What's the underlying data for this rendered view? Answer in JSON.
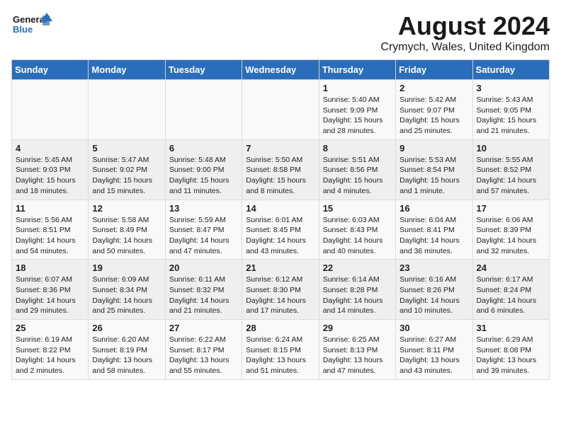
{
  "logo": {
    "line1": "General",
    "line2": "Blue"
  },
  "title": "August 2024",
  "subtitle": "Crymych, Wales, United Kingdom",
  "weekdays": [
    "Sunday",
    "Monday",
    "Tuesday",
    "Wednesday",
    "Thursday",
    "Friday",
    "Saturday"
  ],
  "weeks": [
    [
      {
        "day": "",
        "info": ""
      },
      {
        "day": "",
        "info": ""
      },
      {
        "day": "",
        "info": ""
      },
      {
        "day": "",
        "info": ""
      },
      {
        "day": "1",
        "info": "Sunrise: 5:40 AM\nSunset: 9:09 PM\nDaylight: 15 hours\nand 28 minutes."
      },
      {
        "day": "2",
        "info": "Sunrise: 5:42 AM\nSunset: 9:07 PM\nDaylight: 15 hours\nand 25 minutes."
      },
      {
        "day": "3",
        "info": "Sunrise: 5:43 AM\nSunset: 9:05 PM\nDaylight: 15 hours\nand 21 minutes."
      }
    ],
    [
      {
        "day": "4",
        "info": "Sunrise: 5:45 AM\nSunset: 9:03 PM\nDaylight: 15 hours\nand 18 minutes."
      },
      {
        "day": "5",
        "info": "Sunrise: 5:47 AM\nSunset: 9:02 PM\nDaylight: 15 hours\nand 15 minutes."
      },
      {
        "day": "6",
        "info": "Sunrise: 5:48 AM\nSunset: 9:00 PM\nDaylight: 15 hours\nand 11 minutes."
      },
      {
        "day": "7",
        "info": "Sunrise: 5:50 AM\nSunset: 8:58 PM\nDaylight: 15 hours\nand 8 minutes."
      },
      {
        "day": "8",
        "info": "Sunrise: 5:51 AM\nSunset: 8:56 PM\nDaylight: 15 hours\nand 4 minutes."
      },
      {
        "day": "9",
        "info": "Sunrise: 5:53 AM\nSunset: 8:54 PM\nDaylight: 15 hours\nand 1 minute."
      },
      {
        "day": "10",
        "info": "Sunrise: 5:55 AM\nSunset: 8:52 PM\nDaylight: 14 hours\nand 57 minutes."
      }
    ],
    [
      {
        "day": "11",
        "info": "Sunrise: 5:56 AM\nSunset: 8:51 PM\nDaylight: 14 hours\nand 54 minutes."
      },
      {
        "day": "12",
        "info": "Sunrise: 5:58 AM\nSunset: 8:49 PM\nDaylight: 14 hours\nand 50 minutes."
      },
      {
        "day": "13",
        "info": "Sunrise: 5:59 AM\nSunset: 8:47 PM\nDaylight: 14 hours\nand 47 minutes."
      },
      {
        "day": "14",
        "info": "Sunrise: 6:01 AM\nSunset: 8:45 PM\nDaylight: 14 hours\nand 43 minutes."
      },
      {
        "day": "15",
        "info": "Sunrise: 6:03 AM\nSunset: 8:43 PM\nDaylight: 14 hours\nand 40 minutes."
      },
      {
        "day": "16",
        "info": "Sunrise: 6:04 AM\nSunset: 8:41 PM\nDaylight: 14 hours\nand 36 minutes."
      },
      {
        "day": "17",
        "info": "Sunrise: 6:06 AM\nSunset: 8:39 PM\nDaylight: 14 hours\nand 32 minutes."
      }
    ],
    [
      {
        "day": "18",
        "info": "Sunrise: 6:07 AM\nSunset: 8:36 PM\nDaylight: 14 hours\nand 29 minutes."
      },
      {
        "day": "19",
        "info": "Sunrise: 6:09 AM\nSunset: 8:34 PM\nDaylight: 14 hours\nand 25 minutes."
      },
      {
        "day": "20",
        "info": "Sunrise: 6:11 AM\nSunset: 8:32 PM\nDaylight: 14 hours\nand 21 minutes."
      },
      {
        "day": "21",
        "info": "Sunrise: 6:12 AM\nSunset: 8:30 PM\nDaylight: 14 hours\nand 17 minutes."
      },
      {
        "day": "22",
        "info": "Sunrise: 6:14 AM\nSunset: 8:28 PM\nDaylight: 14 hours\nand 14 minutes."
      },
      {
        "day": "23",
        "info": "Sunrise: 6:16 AM\nSunset: 8:26 PM\nDaylight: 14 hours\nand 10 minutes."
      },
      {
        "day": "24",
        "info": "Sunrise: 6:17 AM\nSunset: 8:24 PM\nDaylight: 14 hours\nand 6 minutes."
      }
    ],
    [
      {
        "day": "25",
        "info": "Sunrise: 6:19 AM\nSunset: 8:22 PM\nDaylight: 14 hours\nand 2 minutes."
      },
      {
        "day": "26",
        "info": "Sunrise: 6:20 AM\nSunset: 8:19 PM\nDaylight: 13 hours\nand 58 minutes."
      },
      {
        "day": "27",
        "info": "Sunrise: 6:22 AM\nSunset: 8:17 PM\nDaylight: 13 hours\nand 55 minutes."
      },
      {
        "day": "28",
        "info": "Sunrise: 6:24 AM\nSunset: 8:15 PM\nDaylight: 13 hours\nand 51 minutes."
      },
      {
        "day": "29",
        "info": "Sunrise: 6:25 AM\nSunset: 8:13 PM\nDaylight: 13 hours\nand 47 minutes."
      },
      {
        "day": "30",
        "info": "Sunrise: 6:27 AM\nSunset: 8:11 PM\nDaylight: 13 hours\nand 43 minutes."
      },
      {
        "day": "31",
        "info": "Sunrise: 6:29 AM\nSunset: 8:08 PM\nDaylight: 13 hours\nand 39 minutes."
      }
    ]
  ]
}
